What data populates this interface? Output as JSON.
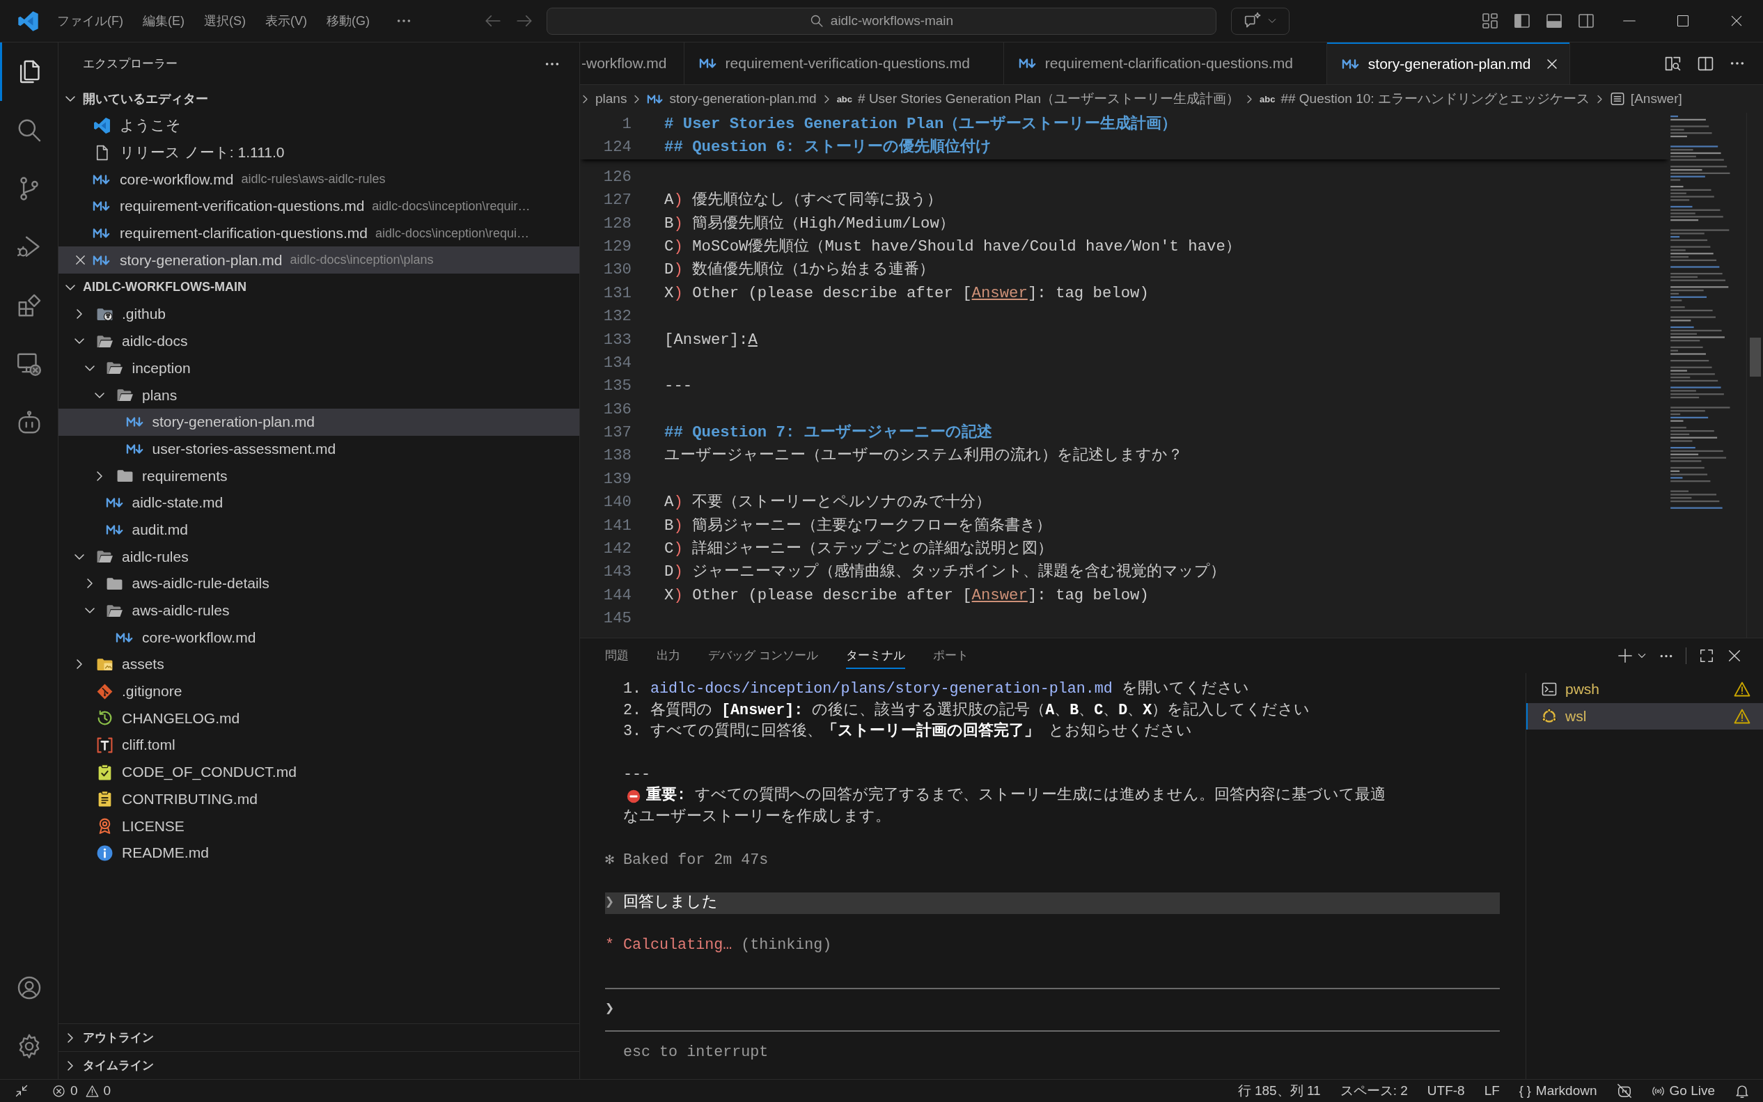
{
  "title_bar": {
    "menu": [
      "ファイル(F)",
      "編集(E)",
      "選択(S)",
      "表示(V)",
      "移動(G)"
    ],
    "navigation": [
      {
        "kind": "back",
        "disabled": true
      },
      {
        "kind": "forward",
        "disabled": true
      }
    ],
    "command_center": "aidlc-workflows-main",
    "layout_toggles": [
      {
        "kind": "customize"
      },
      {
        "kind": "sidebar",
        "on": true
      },
      {
        "kind": "panel",
        "on": true
      },
      {
        "kind": "auxiliary",
        "on": false
      }
    ]
  },
  "activity_bar": {
    "top": [
      {
        "kind": "explorer",
        "selected": true
      },
      {
        "kind": "search",
        "selected": false
      },
      {
        "kind": "scm",
        "selected": false
      },
      {
        "kind": "debug",
        "selected": false
      },
      {
        "kind": "extensions",
        "selected": false
      },
      {
        "kind": "remote",
        "selected": false
      },
      {
        "kind": "assistant",
        "selected": false
      }
    ],
    "bottom": [
      {
        "kind": "accounts"
      },
      {
        "kind": "settings"
      }
    ]
  },
  "sidebar": {
    "title": "エクスプローラー",
    "open_editors": {
      "title": "開いているエディター",
      "expanded": true,
      "items": [
        {
          "kind": "vscode",
          "name": "ようこそ",
          "selected": false
        },
        {
          "kind": "document",
          "name": "リリース ノート: 1.111.0",
          "selected": false
        },
        {
          "kind": "markdown",
          "name": "core-workflow.md",
          "description": "aidlc-rules\\aws-aidlc-rules",
          "selected": false
        },
        {
          "kind": "markdown",
          "name": "requirement-verification-questions.md",
          "description": "aidlc-docs\\inception\\requir…",
          "selected": false
        },
        {
          "kind": "markdown",
          "name": "requirement-clarification-questions.md",
          "description": "aidlc-docs\\inception\\requi…",
          "selected": false
        },
        {
          "kind": "markdown",
          "name": "story-generation-plan.md",
          "description": "aidlc-docs\\inception\\plans",
          "selected": true
        }
      ]
    },
    "folder": {
      "title": "AIDLC-WORKFLOWS-MAIN",
      "expanded": true,
      "children": [
        {
          "name": ".github",
          "kind": "github",
          "expanded": false,
          "selected": false
        },
        {
          "name": "aidlc-docs",
          "kind": "folder",
          "expanded": true,
          "selected": false,
          "children": [
            {
              "name": "inception",
              "kind": "folder",
              "expanded": true,
              "selected": false,
              "children": [
                {
                  "name": "plans",
                  "kind": "folder",
                  "expanded": true,
                  "selected": false,
                  "children": [
                    {
                      "name": "story-generation-plan.md",
                      "kind": "markdown",
                      "selected": true
                    },
                    {
                      "name": "user-stories-assessment.md",
                      "kind": "markdown",
                      "selected": false
                    }
                  ]
                },
                {
                  "name": "requirements",
                  "kind": "folder",
                  "expanded": false,
                  "selected": false
                }
              ]
            },
            {
              "name": "aidlc-state.md",
              "kind": "markdown",
              "selected": false
            },
            {
              "name": "audit.md",
              "kind": "markdown",
              "selected": false
            }
          ]
        },
        {
          "name": "aidlc-rules",
          "kind": "folder",
          "expanded": true,
          "selected": false,
          "children": [
            {
              "name": "aws-aidlc-rule-details",
              "kind": "folder",
              "expanded": false,
              "selected": false
            },
            {
              "name": "aws-aidlc-rules",
              "kind": "folder",
              "expanded": true,
              "selected": false,
              "children": [
                {
                  "name": "core-workflow.md",
                  "kind": "markdown",
                  "selected": false
                }
              ]
            }
          ]
        },
        {
          "name": "assets",
          "kind": "images",
          "expanded": false,
          "selected": false
        },
        {
          "name": ".gitignore",
          "kind": "git",
          "selected": false
        },
        {
          "name": "CHANGELOG.md",
          "kind": "history",
          "selected": false
        },
        {
          "name": "cliff.toml",
          "kind": "toml",
          "selected": false
        },
        {
          "name": "CODE_OF_CONDUCT.md",
          "kind": "conduct",
          "selected": false
        },
        {
          "name": "CONTRIBUTING.md",
          "kind": "contributing",
          "selected": false
        },
        {
          "name": "LICENSE",
          "kind": "license",
          "selected": false
        },
        {
          "name": "README.md",
          "kind": "info",
          "selected": false
        }
      ]
    },
    "sections": [
      {
        "title": "アウトライン",
        "expanded": false
      },
      {
        "title": "タイムライン",
        "expanded": false
      }
    ]
  },
  "editor": {
    "tabs": [
      {
        "label": "-workflow.md",
        "selected": false
      },
      {
        "label": "requirement-verification-questions.md",
        "kind": "markdown",
        "selected": false
      },
      {
        "label": "requirement-clarification-questions.md",
        "kind": "markdown",
        "selected": false
      },
      {
        "label": "story-generation-plan.md",
        "kind": "markdown",
        "selected": true
      }
    ],
    "breadcrumbs": [
      {
        "label": "plans"
      },
      {
        "kind": "markdown",
        "label": "story-generation-plan.md"
      },
      {
        "symbol": "abc",
        "label": "# User Stories Generation Plan（ユーザーストーリー生成計画）"
      },
      {
        "symbol": "abc",
        "label": "## Question 10: エラーハンドリングとエッジケース"
      },
      {
        "kind": "field",
        "label": "[Answer]"
      }
    ],
    "sticky_lines": [
      {
        "number": "1",
        "spans": [
          {
            "kind": "heading",
            "text": "# User Stories Generation Plan（ユーザーストーリー生成計画）"
          }
        ]
      },
      {
        "number": "124",
        "spans": [
          {
            "kind": "heading",
            "text": "## Question 6: ストーリーの優先順位付け"
          }
        ]
      }
    ],
    "lines": [
      {
        "number": "126"
      },
      {
        "number": "127",
        "spans": [
          {
            "kind": "plain",
            "text": "A"
          },
          {
            "kind": "marker",
            "text": ")"
          },
          {
            "kind": "plain",
            "text": " 優先順位なし（すべて同等に扱う）"
          }
        ]
      },
      {
        "number": "128",
        "spans": [
          {
            "kind": "plain",
            "text": "B"
          },
          {
            "kind": "marker",
            "text": ")"
          },
          {
            "kind": "plain",
            "text": " 簡易優先順位（High/Medium/Low）"
          }
        ]
      },
      {
        "number": "129",
        "spans": [
          {
            "kind": "plain",
            "text": "C"
          },
          {
            "kind": "marker",
            "text": ")"
          },
          {
            "kind": "plain",
            "text": " MoSCoW優先順位（Must have/Should have/Could have/Won't have）"
          }
        ]
      },
      {
        "number": "130",
        "spans": [
          {
            "kind": "plain",
            "text": "D"
          },
          {
            "kind": "marker",
            "text": ")"
          },
          {
            "kind": "plain",
            "text": " 数値優先順位（1から始まる連番）"
          }
        ]
      },
      {
        "number": "131",
        "spans": [
          {
            "kind": "plain",
            "text": "X"
          },
          {
            "kind": "marker",
            "text": ")"
          },
          {
            "kind": "plain",
            "text": " Other (please describe after ["
          },
          {
            "kind": "link",
            "text": "Answer"
          },
          {
            "kind": "plain",
            "text": "]: tag below)"
          }
        ]
      },
      {
        "number": "132"
      },
      {
        "number": "133",
        "spans": [
          {
            "kind": "plain",
            "text": "[Answer]:"
          },
          {
            "kind": "underline",
            "text": "A"
          }
        ]
      },
      {
        "number": "134"
      },
      {
        "number": "135",
        "spans": [
          {
            "kind": "plain",
            "text": "---"
          }
        ]
      },
      {
        "number": "136"
      },
      {
        "number": "137",
        "spans": [
          {
            "kind": "heading",
            "text": "## Question 7: ユーザージャーニーの記述"
          }
        ]
      },
      {
        "number": "138",
        "spans": [
          {
            "kind": "plain",
            "text": "ユーザージャーニー（ユーザーのシステム利用の流れ）を記述しますか？"
          }
        ]
      },
      {
        "number": "139"
      },
      {
        "number": "140",
        "spans": [
          {
            "kind": "plain",
            "text": "A"
          },
          {
            "kind": "marker",
            "text": ")"
          },
          {
            "kind": "plain",
            "text": " 不要（ストーリーとペルソナのみで十分）"
          }
        ]
      },
      {
        "number": "141",
        "spans": [
          {
            "kind": "plain",
            "text": "B"
          },
          {
            "kind": "marker",
            "text": ")"
          },
          {
            "kind": "plain",
            "text": " 簡易ジャーニー（主要なワークフローを箇条書き）"
          }
        ]
      },
      {
        "number": "142",
        "spans": [
          {
            "kind": "plain",
            "text": "C"
          },
          {
            "kind": "marker",
            "text": ")"
          },
          {
            "kind": "plain",
            "text": " 詳細ジャーニー（ステップごとの詳細な説明と図）"
          }
        ]
      },
      {
        "number": "143",
        "spans": [
          {
            "kind": "plain",
            "text": "D"
          },
          {
            "kind": "marker",
            "text": ")"
          },
          {
            "kind": "plain",
            "text": " ジャーニーマップ（感情曲線、タッチポイント、課題を含む視覚的マップ）"
          }
        ]
      },
      {
        "number": "144",
        "spans": [
          {
            "kind": "plain",
            "text": "X"
          },
          {
            "kind": "marker",
            "text": ")"
          },
          {
            "kind": "plain",
            "text": " Other (please describe after ["
          },
          {
            "kind": "link",
            "text": "Answer"
          },
          {
            "kind": "plain",
            "text": "]: tag below)"
          }
        ]
      },
      {
        "number": "145"
      }
    ]
  },
  "panel": {
    "tabs": [
      {
        "label": "問題",
        "selected": false
      },
      {
        "label": "出力",
        "selected": false
      },
      {
        "label": "デバッグ コンソール",
        "selected": false
      },
      {
        "label": "ターミナル",
        "selected": true
      },
      {
        "label": "ポート",
        "selected": false
      }
    ],
    "terminal_rows": [
      {
        "kind": "text",
        "spans": [
          {
            "kind": "plain",
            "text": "  1. "
          },
          {
            "kind": "path",
            "text": "aidlc-docs/inception/plans/story-generation-plan.md"
          },
          {
            "kind": "plain",
            "text": " を開いてください"
          }
        ]
      },
      {
        "kind": "text",
        "spans": [
          {
            "kind": "plain",
            "text": "  2. 各質問の **[Answer]:** の後に、該当する選択肢の記号（**A**、**B**、**C**、**D**、**X**）を記入してください"
          }
        ]
      },
      {
        "kind": "text",
        "spans": [
          {
            "kind": "plain",
            "text": "  3. すべての質問に回答後、**「ストーリー計画の回答完了」** とお知らせください"
          }
        ]
      },
      {
        "kind": "blank"
      },
      {
        "kind": "text",
        "spans": [
          {
            "kind": "plain",
            "text": "  ---"
          }
        ]
      },
      {
        "kind": "alert",
        "spans": [
          {
            "kind": "plain",
            "text": "**重要:** すべての質問への回答が完了するまで、ストーリー生成には進めません。回答内容に基づいて最適"
          }
        ]
      },
      {
        "kind": "text",
        "spans": [
          {
            "kind": "plain",
            "text": "  なユーザーストーリーを作成します。"
          }
        ]
      },
      {
        "kind": "blank"
      },
      {
        "kind": "text",
        "spans": [
          {
            "kind": "dim",
            "text": "✻ Baked for 2m 47s"
          }
        ]
      },
      {
        "kind": "blank"
      },
      {
        "kind": "echo",
        "spans": [
          {
            "kind": "dim",
            "text": "❯ "
          },
          {
            "kind": "bright",
            "text": "回答しました"
          }
        ]
      },
      {
        "kind": "blank"
      },
      {
        "kind": "text",
        "spans": [
          {
            "kind": "accent",
            "text": "* Calculating…"
          },
          {
            "kind": "dim",
            "text": " (thinking)"
          }
        ]
      },
      {
        "kind": "blank"
      },
      {
        "kind": "rule"
      },
      {
        "kind": "prompt",
        "text": "❯"
      },
      {
        "kind": "rule"
      },
      {
        "kind": "text",
        "spans": [
          {
            "kind": "dim",
            "text": "  esc to interrupt"
          }
        ]
      }
    ],
    "terminals": [
      {
        "label": "pwsh",
        "kind": "shell",
        "selected": false,
        "warning": true
      },
      {
        "label": "wsl",
        "kind": "linux",
        "selected": true,
        "warning": true
      }
    ]
  },
  "status_bar": {
    "problems": {
      "errors": "0",
      "warnings": "0"
    },
    "items": [
      {
        "kind": "text",
        "label": "行 185、列 11"
      },
      {
        "kind": "text",
        "label": "スペース: 2"
      },
      {
        "kind": "text",
        "label": "UTF-8"
      },
      {
        "kind": "text",
        "label": "LF"
      },
      {
        "kind": "language",
        "symbol": "{ }",
        "label": "Markdown"
      },
      {
        "kind": "assistant"
      },
      {
        "kind": "live",
        "label": "Go Live"
      },
      {
        "kind": "bell"
      }
    ]
  }
}
